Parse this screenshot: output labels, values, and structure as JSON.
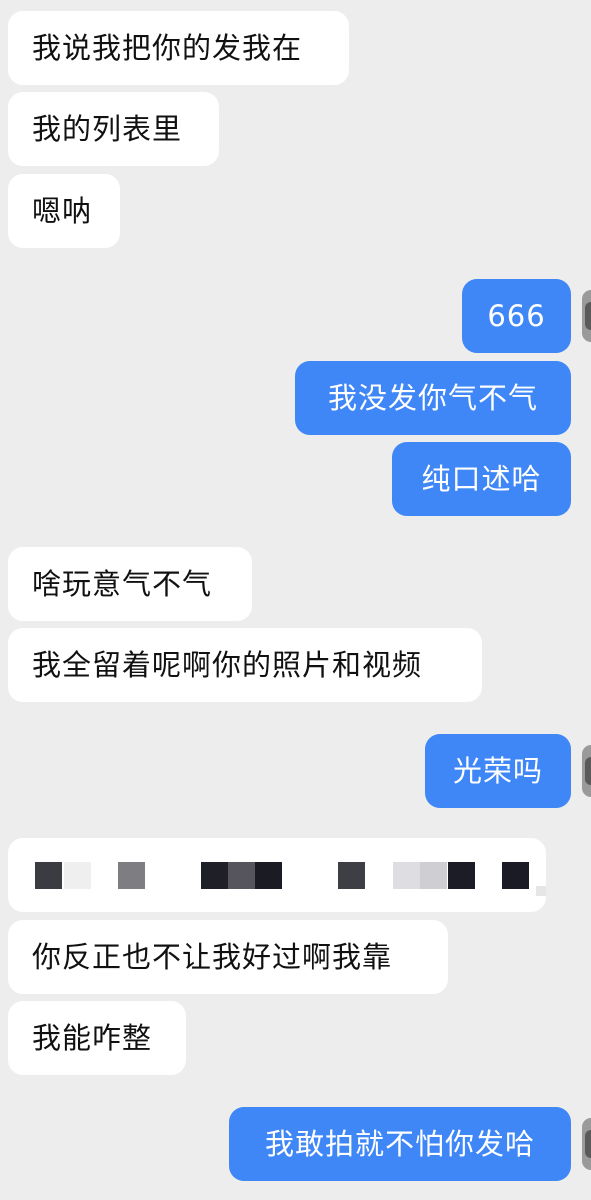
{
  "messages": [
    {
      "side": "in",
      "text": "我说我把你的发我在"
    },
    {
      "side": "in",
      "text": "我的列表里"
    },
    {
      "side": "in",
      "text": "嗯呐"
    },
    {
      "side": "out",
      "text": "666"
    },
    {
      "side": "out",
      "text": "我没发你气不气"
    },
    {
      "side": "out",
      "text": "纯口述哈"
    },
    {
      "side": "in",
      "text": "啥玩意气不气"
    },
    {
      "side": "in",
      "text": "我全留着呢啊你的照片和视频"
    },
    {
      "side": "out",
      "text": "光荣吗"
    },
    {
      "side": "in",
      "text": ""
    },
    {
      "side": "in",
      "text": "你反正也不让我好过啊我靠"
    },
    {
      "side": "in",
      "text": "我能咋整"
    },
    {
      "side": "out",
      "text": "我敢拍就不怕你发哈"
    }
  ],
  "colors": {
    "background": "#ededed",
    "incoming_bubble": "#ffffff",
    "outgoing_bubble": "#3f86f7",
    "incoming_text": "#111111",
    "outgoing_text": "#ffffff"
  }
}
